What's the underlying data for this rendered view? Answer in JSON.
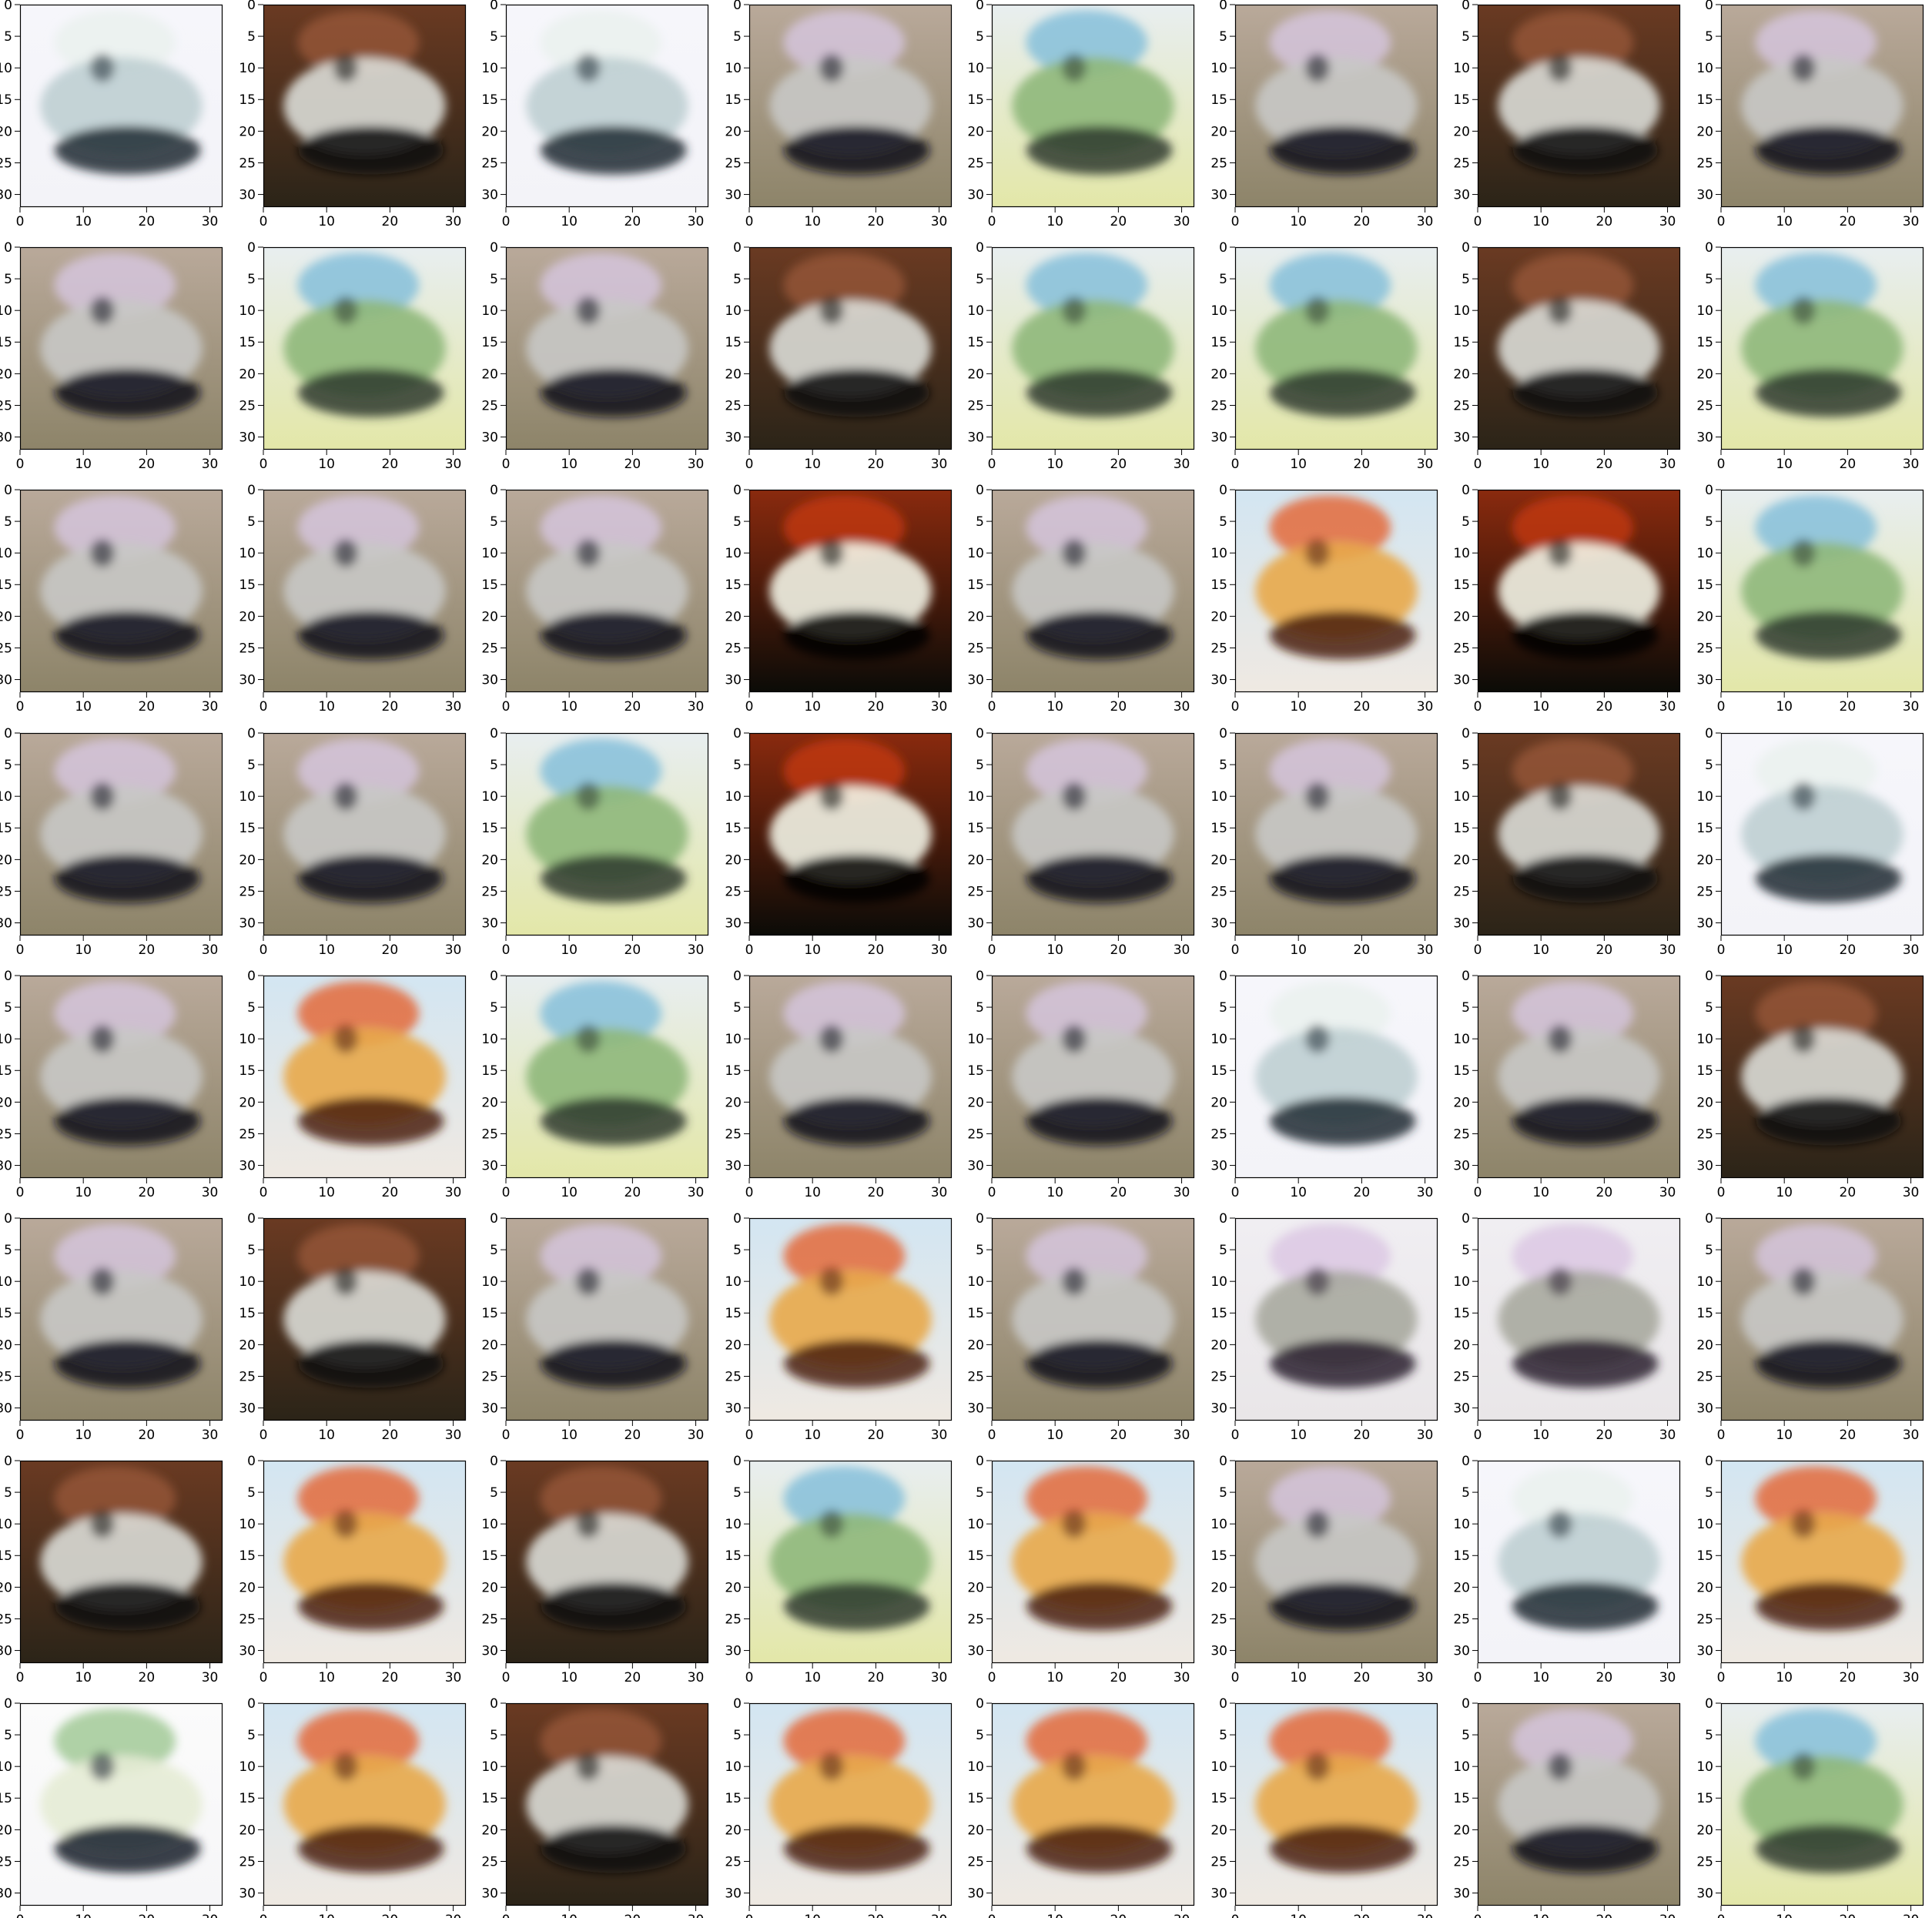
{
  "grid": {
    "rows": 8,
    "cols": 8
  },
  "axis": {
    "x_ticks": [
      "0",
      "10",
      "20",
      "30"
    ],
    "y_ticks": [
      "0",
      "5",
      "10",
      "15",
      "20",
      "25",
      "30"
    ],
    "xlim": [
      0,
      32
    ],
    "ylim": [
      0,
      32
    ]
  },
  "styles": {
    "A": {
      "name": "gray-car-dark-bottom",
      "bg_top": "#b9a99a",
      "bg_bottom": "#8d8469",
      "body": "#c8c8c5",
      "dark": "#0c0d1a",
      "accent": "#d9c9e6"
    },
    "B": {
      "name": "silver-car-white-bg",
      "bg_top": "#f6f6fb",
      "bg_bottom": "#f3f3f8",
      "body": "#bfcfd3",
      "dark": "#1f2c34",
      "accent": "#e8f0ec"
    },
    "C": {
      "name": "blue-green-yellow-scene",
      "bg_top": "#e8eef0",
      "bg_bottom": "#e3e7a8",
      "body": "#8fb87a",
      "dark": "#2d3a2f",
      "accent": "#78b9d8"
    },
    "D": {
      "name": "dark-red-white-blob",
      "bg_top": "#8a2a0e",
      "bg_bottom": "#0b0b07",
      "body": "#f2f3e6",
      "dark": "#060604",
      "accent": "#c83a12"
    },
    "E": {
      "name": "orange-yellow-colorful",
      "bg_top": "#d3e6f2",
      "bg_bottom": "#efe9e2",
      "body": "#e8a94a",
      "dark": "#4a1f12",
      "accent": "#e45a22"
    },
    "F": {
      "name": "brown-white-dark",
      "bg_top": "#6a3a22",
      "bg_bottom": "#2b2418",
      "body": "#dadcd6",
      "dark": "#0a0a08",
      "accent": "#9b5a3a"
    },
    "G": {
      "name": "faded-car-white",
      "bg_top": "#f0eef2",
      "bg_bottom": "#e9e6e8",
      "body": "#a8aaa0",
      "dark": "#2a2030",
      "accent": "#d9c3e2"
    },
    "H": {
      "name": "white-green-car",
      "bg_top": "#fbfbfb",
      "bg_bottom": "#f6f6f8",
      "body": "#e5ecd5",
      "dark": "#151e2c",
      "accent": "#96c38a"
    }
  },
  "tiles": [
    "B",
    "F",
    "B",
    "A",
    "C",
    "A",
    "F",
    "A",
    "A",
    "C",
    "A",
    "F",
    "C",
    "C",
    "F",
    "C",
    "A",
    "A",
    "A",
    "D",
    "A",
    "E",
    "D",
    "C",
    "A",
    "A",
    "C",
    "D",
    "A",
    "A",
    "F",
    "B",
    "A",
    "E",
    "C",
    "A",
    "A",
    "B",
    "A",
    "F",
    "A",
    "F",
    "A",
    "E",
    "A",
    "G",
    "G",
    "A",
    "F",
    "E",
    "F",
    "C",
    "E",
    "A",
    "B",
    "E",
    "H",
    "E",
    "F",
    "E",
    "E",
    "E",
    "A",
    "C"
  ]
}
